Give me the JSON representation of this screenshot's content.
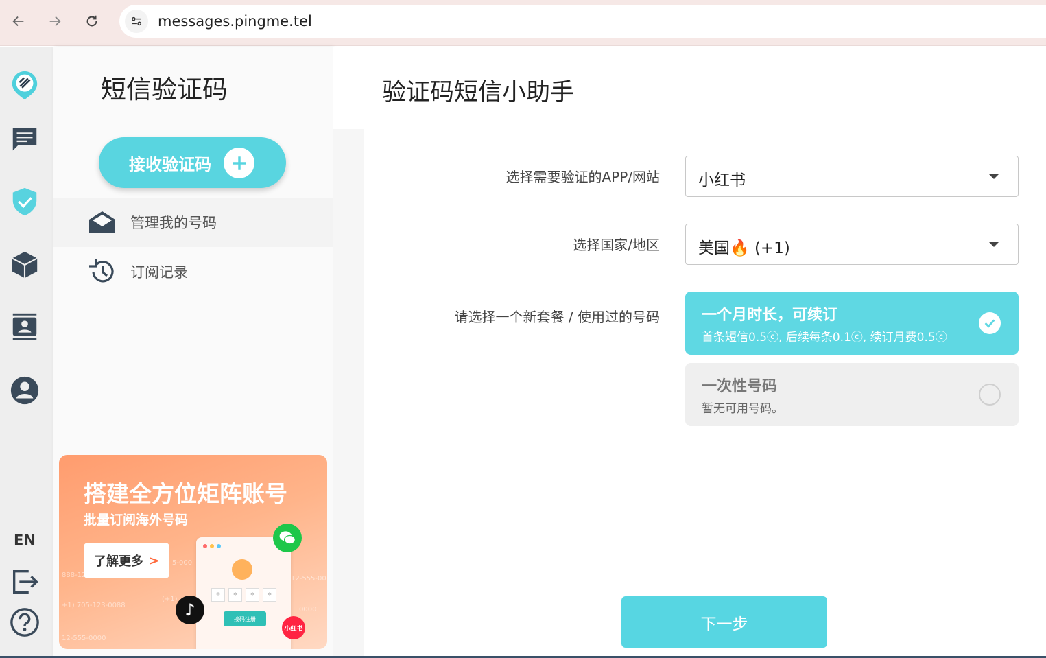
{
  "browser": {
    "url": "messages.pingme.tel"
  },
  "rail": {
    "items": [
      {
        "name": "pingme-logo-icon"
      },
      {
        "name": "messages-icon"
      },
      {
        "name": "shield-check-icon"
      },
      {
        "name": "box-icon"
      },
      {
        "name": "contacts-icon"
      },
      {
        "name": "account-icon"
      }
    ],
    "language": "EN"
  },
  "sidebar": {
    "title": "短信验证码",
    "receive_button": "接收验证码",
    "menu": [
      {
        "label": "管理我的号码",
        "icon": "mail-open-icon"
      },
      {
        "label": "订阅记录",
        "icon": "history-icon"
      }
    ],
    "promo": {
      "title": "搭建全方位矩阵账号",
      "subtitle": "批量订阅海外号码",
      "button": "了解更多",
      "button_arrow": ">",
      "mini_button": "接码注册",
      "xhs_logo": "小红书",
      "faint_numbers": [
        "888-12",
        "+1) 705-123-0088",
        "12-555-0000",
        "(+1)",
        "5-000",
        "12-555-00",
        "0000"
      ]
    }
  },
  "main": {
    "title": "验证码短信小助手",
    "fields": [
      {
        "label": "选择需要验证的APP/网站",
        "value": "小红书"
      },
      {
        "label": "选择国家/地区",
        "value": "美国🔥 (+1)"
      }
    ],
    "plan_label": "请选择一个新套餐 / 使用过的号码",
    "plans": [
      {
        "title": "一个月时长，可续订",
        "desc": "首条短信0.5ⓒ, 后续每条0.1ⓒ, 续订月费0.5ⓒ",
        "selected": true
      },
      {
        "title": "一次性号码",
        "desc": "暂无可用号码。",
        "selected": false
      }
    ],
    "next_button": "下一步"
  },
  "colors": {
    "accent": "#59d5e0",
    "promo": "#ff9c6e",
    "browser_bar": "#f6e8e6"
  }
}
